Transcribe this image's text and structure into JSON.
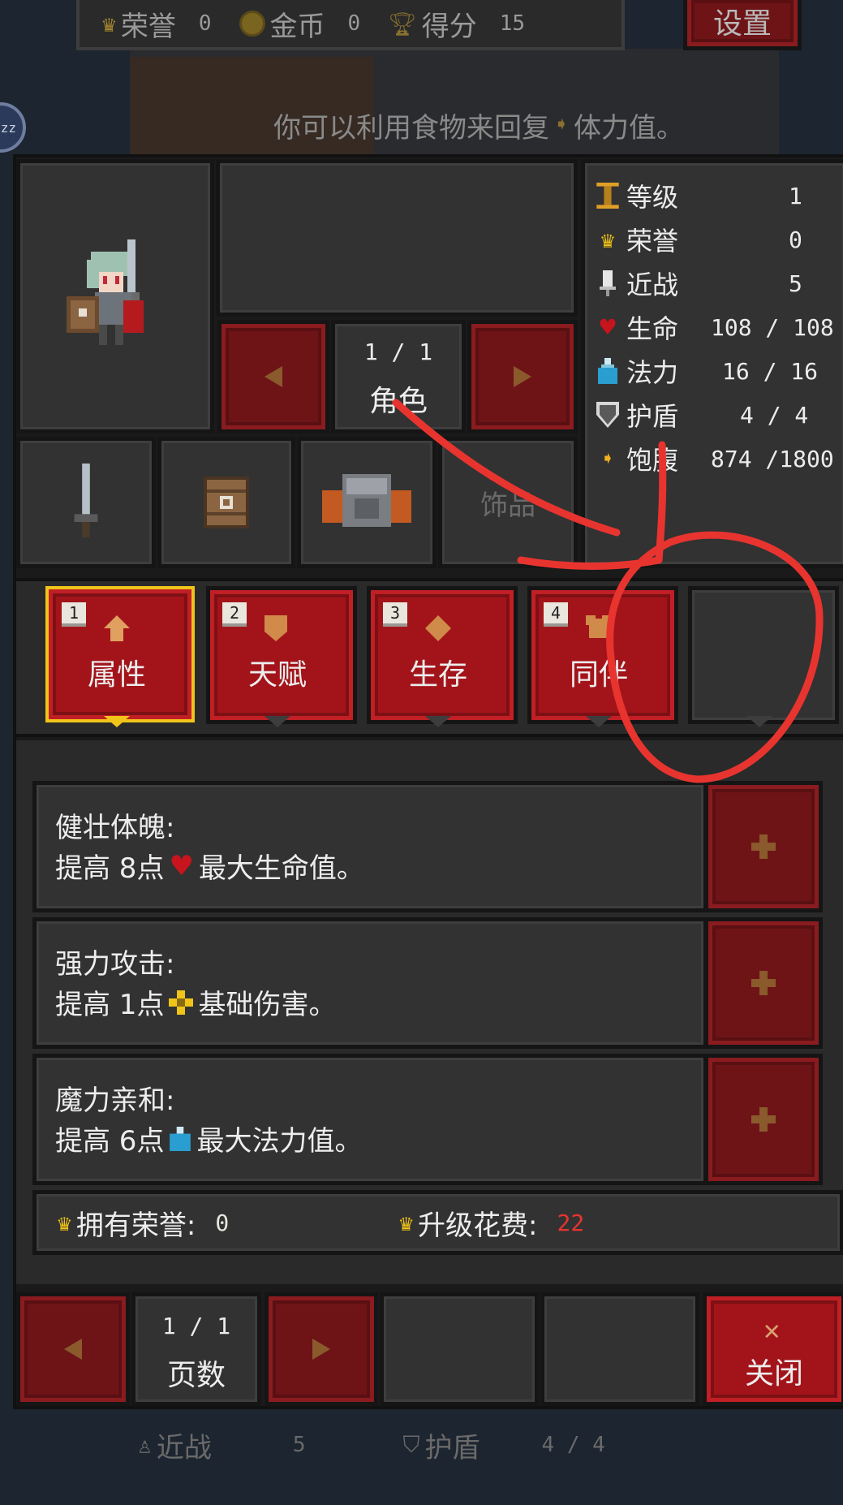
{
  "colors": {
    "panel": "#323232",
    "red_button": "#6e1417",
    "red_button_bright": "#a3141a",
    "accent_gold": "#f0c419",
    "annotation": "#e8342f",
    "cost_red": "#e8342f"
  },
  "top_bar": {
    "honor_label": "荣誉",
    "honor_value": "0",
    "gold_label": "金币",
    "gold_value": "0",
    "score_label": "得分",
    "score_value": "15",
    "settings_label": "设置"
  },
  "hint": {
    "text_before": "你可以利用食物来回复",
    "text_after": "体力值。",
    "badge": "zz"
  },
  "character": {
    "page": "1 / 1",
    "section_label": "角色",
    "accessory_label": "饰品"
  },
  "stats": [
    {
      "icon": "level-icon",
      "label": "等级",
      "value": "1"
    },
    {
      "icon": "crown-icon",
      "label": "荣誉",
      "value": "0"
    },
    {
      "icon": "melee-icon",
      "label": "近战",
      "value": "5"
    },
    {
      "icon": "heart-icon",
      "label": "生命",
      "value": "108 / 108"
    },
    {
      "icon": "potion-icon",
      "label": "法力",
      "value": "16 / 16"
    },
    {
      "icon": "shield-icon",
      "label": "护盾",
      "value": "4 / 4"
    },
    {
      "icon": "satiety-icon",
      "label": "饱腹",
      "value": "874 /1800"
    }
  ],
  "tabs": [
    {
      "num": "1",
      "label": "属性",
      "icon": "arrow-up-icon"
    },
    {
      "num": "2",
      "label": "天赋",
      "icon": "shield-badge-icon"
    },
    {
      "num": "3",
      "label": "生存",
      "icon": "diamond-icon"
    },
    {
      "num": "4",
      "label": "同伴",
      "icon": "armor-icon"
    }
  ],
  "upgrades": [
    {
      "title": "健壮体魄:",
      "desc_pre": "提高 8点",
      "desc_post": "最大生命值。",
      "icon": "heart-icon"
    },
    {
      "title": "强力攻击:",
      "desc_pre": "提高 1点",
      "desc_post": "基础伤害。",
      "icon": "damage-icon"
    },
    {
      "title": "魔力亲和:",
      "desc_pre": "提高 6点",
      "desc_post": "最大法力值。",
      "icon": "potion-icon"
    }
  ],
  "footer": {
    "owned_label": "拥有荣誉:",
    "owned_value": "0",
    "cost_label": "升级花费:",
    "cost_value": "22"
  },
  "bottom_nav": {
    "page": "1 / 1",
    "page_label": "页数",
    "close_label": "关闭"
  },
  "behind": {
    "melee_label": "近战",
    "melee_value": "5",
    "shield_label": "护盾",
    "shield_value": "4 / 4"
  }
}
